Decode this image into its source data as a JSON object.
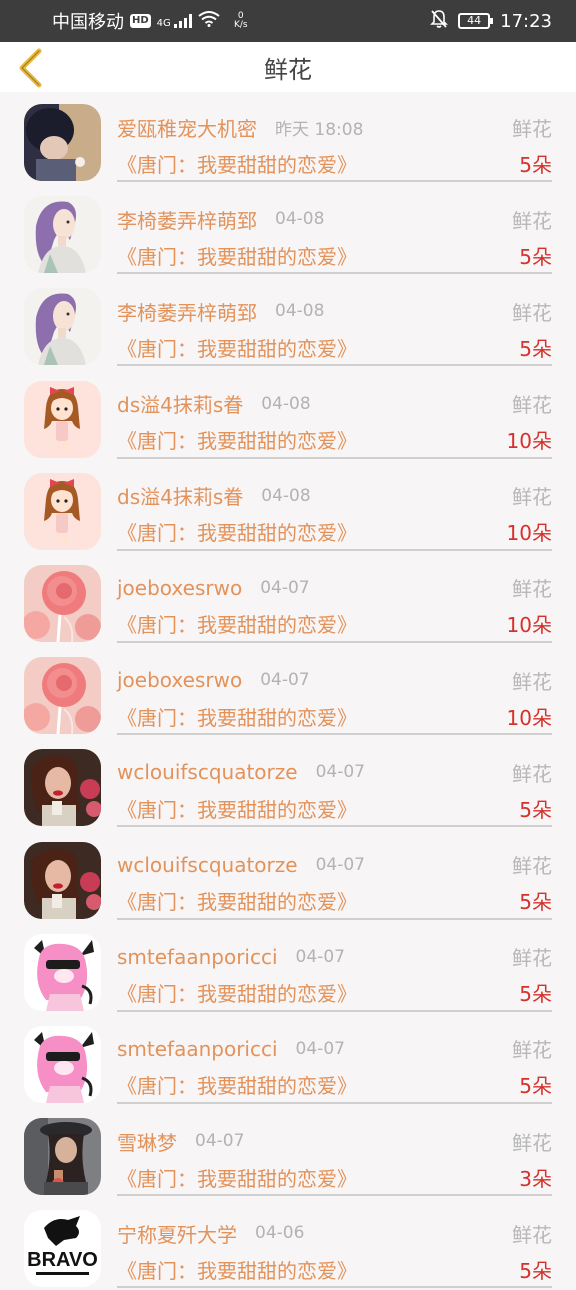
{
  "status_bar": {
    "carrier": "中国移动",
    "hd": "HD",
    "signal_type": "4G",
    "net_speed_value": "0",
    "net_speed_unit": "K/s",
    "battery": "44",
    "time": "17:23"
  },
  "header": {
    "title": "鲜花"
  },
  "items": [
    {
      "name": "爱瓯稚宠大机密",
      "date": "昨天 18:08",
      "gift": "鲜花",
      "book": "《唐门：我要甜甜的恋爱》",
      "amount": "5朵"
    },
    {
      "name": "李椅萎弄梓萌郅",
      "date": "04-08",
      "gift": "鲜花",
      "book": "《唐门：我要甜甜的恋爱》",
      "amount": "5朵"
    },
    {
      "name": "李椅萎弄梓萌郅",
      "date": "04-08",
      "gift": "鲜花",
      "book": "《唐门：我要甜甜的恋爱》",
      "amount": "5朵"
    },
    {
      "name": "ds溢4抹莉s眷",
      "date": "04-08",
      "gift": "鲜花",
      "book": "《唐门：我要甜甜的恋爱》",
      "amount": "10朵"
    },
    {
      "name": "ds溢4抹莉s眷",
      "date": "04-08",
      "gift": "鲜花",
      "book": "《唐门：我要甜甜的恋爱》",
      "amount": "10朵"
    },
    {
      "name": "joeboxesrwo",
      "date": "04-07",
      "gift": "鲜花",
      "book": "《唐门：我要甜甜的恋爱》",
      "amount": "10朵"
    },
    {
      "name": "joeboxesrwo",
      "date": "04-07",
      "gift": "鲜花",
      "book": "《唐门：我要甜甜的恋爱》",
      "amount": "10朵"
    },
    {
      "name": "wclouifscquatorze",
      "date": "04-07",
      "gift": "鲜花",
      "book": "《唐门：我要甜甜的恋爱》",
      "amount": "5朵"
    },
    {
      "name": "wclouifscquatorze",
      "date": "04-07",
      "gift": "鲜花",
      "book": "《唐门：我要甜甜的恋爱》",
      "amount": "5朵"
    },
    {
      "name": "smtefaanporicci",
      "date": "04-07",
      "gift": "鲜花",
      "book": "《唐门：我要甜甜的恋爱》",
      "amount": "5朵"
    },
    {
      "name": "smtefaanporicci",
      "date": "04-07",
      "gift": "鲜花",
      "book": "《唐门：我要甜甜的恋爱》",
      "amount": "5朵"
    },
    {
      "name": "雪琳梦",
      "date": "04-07",
      "gift": "鲜花",
      "book": "《唐门：我要甜甜的恋爱》",
      "amount": "3朵"
    },
    {
      "name": "宁称夏歼大学",
      "date": "04-06",
      "gift": "鲜花",
      "book": "《唐门：我要甜甜的恋爱》",
      "amount": "5朵"
    }
  ],
  "avatar_logo_text": "BRAVO",
  "colors": {
    "name": "#e3935a",
    "book": "#e3935a",
    "amount": "#d6312c",
    "date": "#b3b3b3",
    "gift": "#b8b8b8",
    "back_arrow": "#e8b93a"
  }
}
